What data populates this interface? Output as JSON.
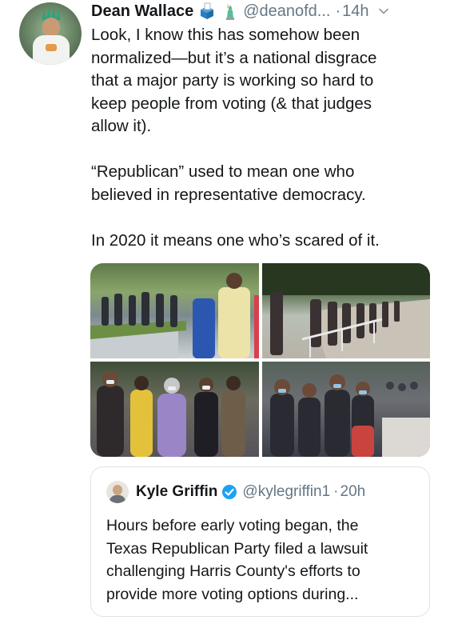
{
  "tweet": {
    "author_name": "Dean Wallace",
    "handle": "@deanofd...",
    "separator": "·",
    "time": "14h",
    "badge_icons": [
      "ballot-box-emoji",
      "statue-of-liberty-emoji"
    ],
    "text_lines": [
      "Look, I know this has somehow been",
      "normalized—but it’s a national disgrace",
      "that a major party is working so hard to",
      "keep people from voting (& that judges",
      "allow it).",
      "",
      "“Republican” used to mean one who",
      "believed in representative democracy.",
      "",
      "In 2020 it means one who’s scared of it."
    ],
    "photos": [
      {
        "subject": "voters-waiting-in-line-on-sidewalk"
      },
      {
        "subject": "long-line-of-voters-along-path"
      },
      {
        "subject": "masked-voters-in-line"
      },
      {
        "subject": "crowd-of-masked-voters"
      }
    ]
  },
  "quoted_tweet": {
    "author_name": "Kyle Griffin",
    "handle": "@kylegriffin1",
    "separator": "·",
    "time": "20h",
    "text_lines": [
      "Hours before early voting began, the",
      "Texas Republican Party filed a lawsuit",
      "challenging Harris County's efforts to",
      "provide more voting options during..."
    ]
  },
  "colors": {
    "text": "#14171a",
    "secondary": "#657786",
    "verified_blue": "#1da1f2",
    "border": "#dfe3e6"
  }
}
